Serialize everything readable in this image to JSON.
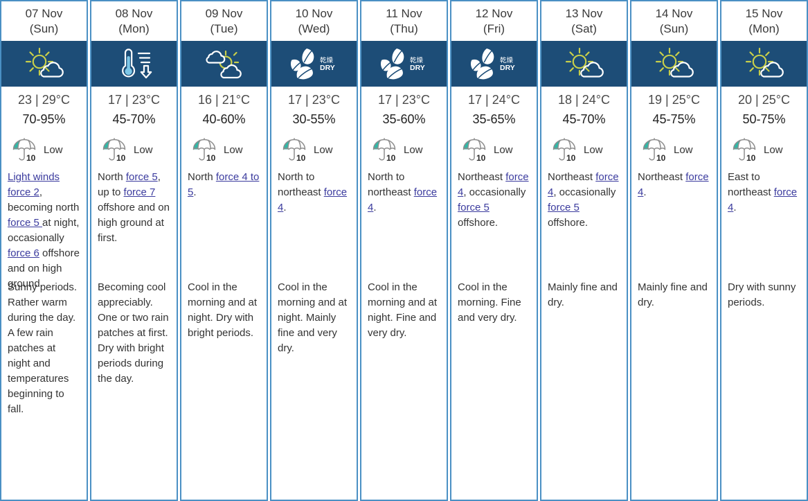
{
  "theme": {
    "border_color": "#4a90c4",
    "icon_band_bg": "#1d4d77",
    "link_color": "#3b3b9e",
    "sun_color": "#c8cf4a",
    "cloud_color": "#ffffff",
    "umbrella_accent": "#2fb9a8",
    "thermometer_color": "#7ec8e8"
  },
  "uv": {
    "scale_max": "10",
    "level_label": "Low",
    "icon": "umbrella-uv-icon"
  },
  "days": [
    {
      "date": "07 Nov",
      "dow": "(Sun)",
      "icon": "sun-behind-cloud-icon",
      "temp": "23 | 29°C",
      "humidity": "70-95%",
      "uv_level": "Low",
      "wind_parts": [
        {
          "t": "Light winds ",
          "link": true
        },
        {
          "t": "force 2",
          "link": true
        },
        {
          "t": ", becoming north ",
          "link": false
        },
        {
          "t": "force 5 ",
          "link": true
        },
        {
          "t": "at night, occasionally ",
          "link": false
        },
        {
          "t": "force 6",
          "link": true
        },
        {
          "t": " offshore and on high ground.",
          "link": false
        }
      ],
      "weather": "Sunny periods. Rather warm during the day. A few rain patches at night and temperatures beginning to fall."
    },
    {
      "date": "08 Nov",
      "dow": "(Mon)",
      "icon": "thermometer-falling-icon",
      "temp": "17 | 23°C",
      "humidity": "45-70%",
      "uv_level": "Low",
      "wind_parts": [
        {
          "t": "North ",
          "link": false
        },
        {
          "t": "force 5",
          "link": true
        },
        {
          "t": ", up to ",
          "link": false
        },
        {
          "t": "force 7",
          "link": true
        },
        {
          "t": " offshore and on high ground at first.",
          "link": false
        }
      ],
      "weather": "Becoming cool appreciably. One or two rain patches at first. Dry with bright periods during the day."
    },
    {
      "date": "09 Nov",
      "dow": "(Tue)",
      "icon": "sun-between-clouds-icon",
      "temp": "16 | 21°C",
      "humidity": "40-60%",
      "uv_level": "Low",
      "wind_parts": [
        {
          "t": "North ",
          "link": false
        },
        {
          "t": "force 4 to 5",
          "link": true
        },
        {
          "t": ".",
          "link": false
        }
      ],
      "weather": "Cool in the morning and at night. Dry with bright periods."
    },
    {
      "date": "10 Nov",
      "dow": "(Wed)",
      "icon": "dry-leaves-icon",
      "temp": "17 | 23°C",
      "humidity": "30-55%",
      "uv_level": "Low",
      "wind_parts": [
        {
          "t": "North to northeast ",
          "link": false
        },
        {
          "t": "force 4",
          "link": true
        },
        {
          "t": ".",
          "link": false
        }
      ],
      "weather": "Cool in the morning and at night. Mainly fine and very dry."
    },
    {
      "date": "11 Nov",
      "dow": "(Thu)",
      "icon": "dry-leaves-icon",
      "temp": "17 | 23°C",
      "humidity": "35-60%",
      "uv_level": "Low",
      "wind_parts": [
        {
          "t": "North to northeast ",
          "link": false
        },
        {
          "t": "force 4",
          "link": true
        },
        {
          "t": ".",
          "link": false
        }
      ],
      "weather": "Cool in the morning and at night. Fine and very dry."
    },
    {
      "date": "12 Nov",
      "dow": "(Fri)",
      "icon": "dry-leaves-icon",
      "temp": "17 | 24°C",
      "humidity": "35-65%",
      "uv_level": "Low",
      "wind_parts": [
        {
          "t": "Northeast ",
          "link": false
        },
        {
          "t": "force 4",
          "link": true
        },
        {
          "t": ", occasionally ",
          "link": false
        },
        {
          "t": "force 5",
          "link": true
        },
        {
          "t": " offshore.",
          "link": false
        }
      ],
      "weather": "Cool in the morning. Fine and very dry."
    },
    {
      "date": "13 Nov",
      "dow": "(Sat)",
      "icon": "sun-behind-cloud-icon",
      "temp": "18 | 24°C",
      "humidity": "45-70%",
      "uv_level": "Low",
      "wind_parts": [
        {
          "t": "Northeast ",
          "link": false
        },
        {
          "t": "force 4",
          "link": true
        },
        {
          "t": ", occasionally ",
          "link": false
        },
        {
          "t": "force 5",
          "link": true
        },
        {
          "t": " offshore.",
          "link": false
        }
      ],
      "weather": "Mainly fine and dry."
    },
    {
      "date": "14 Nov",
      "dow": "(Sun)",
      "icon": "sun-behind-cloud-icon",
      "temp": "19 | 25°C",
      "humidity": "45-75%",
      "uv_level": "Low",
      "wind_parts": [
        {
          "t": "Northeast ",
          "link": false
        },
        {
          "t": "force 4",
          "link": true
        },
        {
          "t": ".",
          "link": false
        }
      ],
      "weather": "Mainly fine and dry."
    },
    {
      "date": "15 Nov",
      "dow": "(Mon)",
      "icon": "sun-behind-cloud-icon",
      "temp": "20 | 25°C",
      "humidity": "50-75%",
      "uv_level": "Low",
      "wind_parts": [
        {
          "t": "East to northeast ",
          "link": false
        },
        {
          "t": "force 4",
          "link": true
        },
        {
          "t": ".",
          "link": false
        }
      ],
      "weather": "Dry with sunny periods."
    }
  ],
  "icon_text": {
    "dry_zh": "乾燥",
    "dry_en": "DRY"
  }
}
